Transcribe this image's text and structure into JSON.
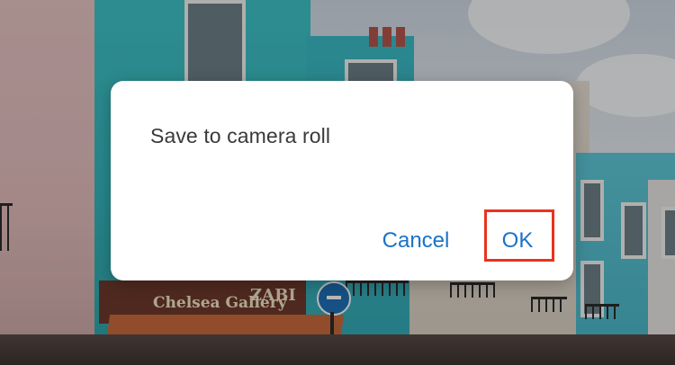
{
  "dialog": {
    "message": "Save to camera roll",
    "cancel_label": "Cancel",
    "ok_label": "OK"
  },
  "background": {
    "shop_sign_1": "Chelsea Gallery",
    "shop_sign_2": "ZABI"
  },
  "colors": {
    "dialog_button": "#1a73c8",
    "highlight": "#e8331c"
  }
}
